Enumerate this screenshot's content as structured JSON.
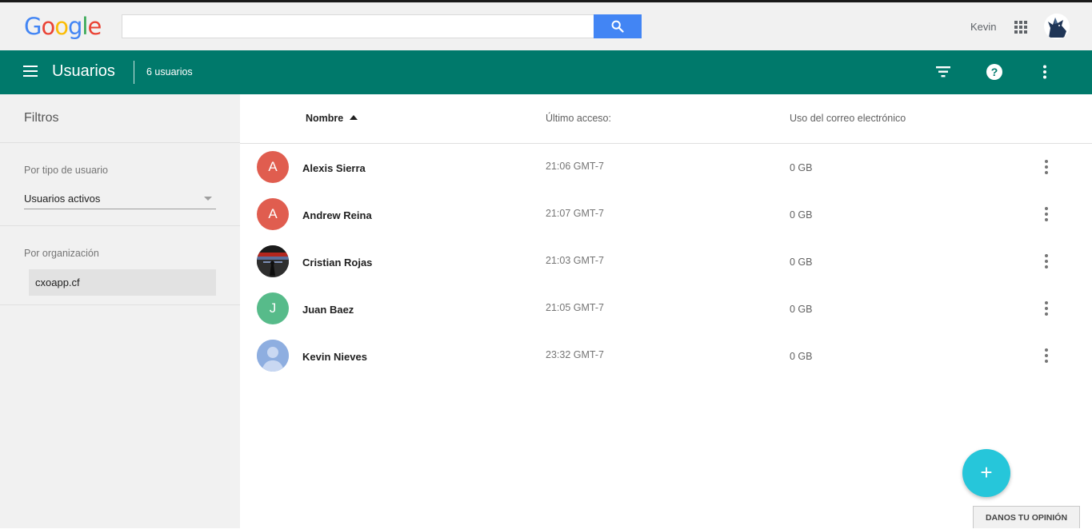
{
  "header": {
    "logo_text": "Google",
    "search": {
      "value": "",
      "placeholder": ""
    },
    "search_icon": "search-icon",
    "user_name": "Kevin",
    "apps_icon": "apps-grid-icon"
  },
  "appbar": {
    "title": "Usuarios",
    "count": "6 usuarios",
    "icons": [
      "menu-icon",
      "filter-icon",
      "help-icon",
      "more-vert-icon"
    ],
    "color": "#00796b"
  },
  "sidebar": {
    "title": "Filtros",
    "user_type_label": "Por tipo de usuario",
    "user_type_value": "Usuarios activos",
    "org_label": "Por organización",
    "org_value": "cxoapp.cf"
  },
  "table": {
    "columns": {
      "name": "Nombre",
      "last_access": "Último acceso:",
      "email_usage": "Uso del correo electrónico"
    },
    "rows": [
      {
        "initial": "A",
        "avatar_color": "#e05d4f",
        "name": "Alexis Sierra",
        "last_access": "21:06 GMT-7",
        "usage": "0 GB"
      },
      {
        "initial": "A",
        "avatar_color": "#e05d4f",
        "name": "Andrew Reina",
        "last_access": "21:07 GMT-7",
        "usage": "0 GB"
      },
      {
        "initial": "",
        "avatar_color": "#2a2a2a",
        "name": "Cristian Rojas",
        "last_access": "21:03 GMT-7",
        "usage": "0 GB"
      },
      {
        "initial": "J",
        "avatar_color": "#57bb8a",
        "name": "Juan Baez",
        "last_access": "21:05 GMT-7",
        "usage": "0 GB"
      },
      {
        "initial": "",
        "avatar_color": "#8eaee0",
        "name": "Kevin Nieves",
        "last_access": "23:32 GMT-7",
        "usage": "0 GB"
      }
    ]
  },
  "fab": {
    "label": "+",
    "color": "#26c6da"
  },
  "feedback": {
    "label": "DANOS TU OPINIÓN"
  }
}
